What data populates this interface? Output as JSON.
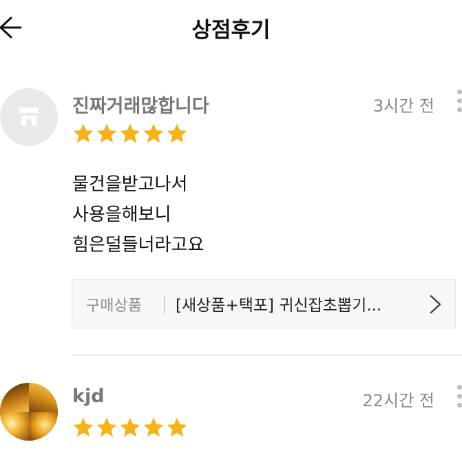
{
  "header": {
    "title": "상점후기",
    "back_icon": "arrow-left-icon"
  },
  "reviews": [
    {
      "name": "진짜거래많합니다",
      "time": "3시간 전",
      "rating": 5,
      "avatar": "store-icon",
      "text_lines": [
        "물건을받고나서",
        "사용을해보니",
        "힘은덜들너라고요"
      ],
      "product": {
        "prefix": "구매상품",
        "name": "[새상품+택포] 귀신잡초뽑기...",
        "chevron_icon": "chevron-right-icon"
      }
    },
    {
      "name": "kjd",
      "time": "22시간 전",
      "rating": 5,
      "avatar": "user-photo"
    }
  ],
  "colors": {
    "star": "#f6b21b",
    "name": "#777777",
    "time": "#8a8a8a",
    "product_bg": "#f7f7f7"
  }
}
